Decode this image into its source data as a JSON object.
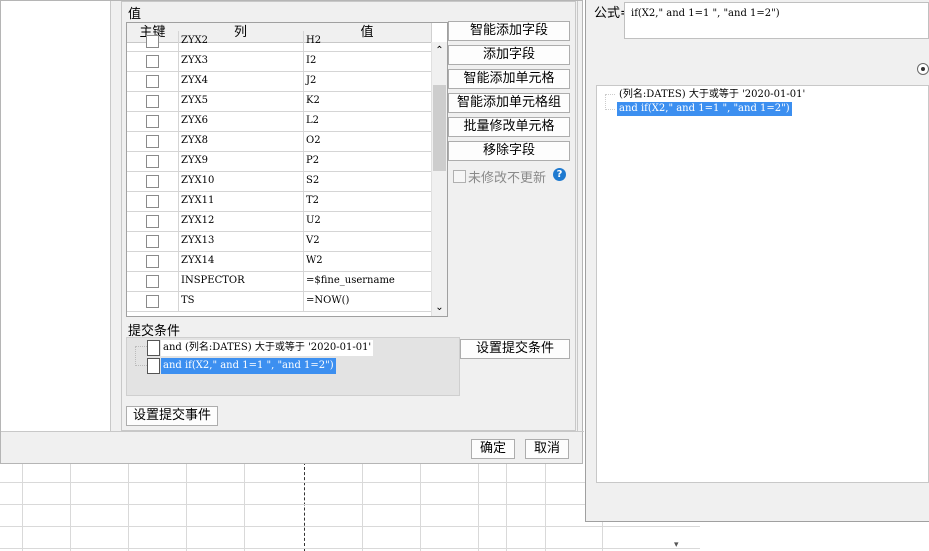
{
  "main_dialog": {
    "values_label": "值",
    "columns": {
      "key": "主键",
      "column": "列",
      "value": "值"
    },
    "rows": [
      {
        "column": "ZYX2",
        "value": "H2"
      },
      {
        "column": "ZYX3",
        "value": "I2"
      },
      {
        "column": "ZYX4",
        "value": "J2"
      },
      {
        "column": "ZYX5",
        "value": "K2"
      },
      {
        "column": "ZYX6",
        "value": "L2"
      },
      {
        "column": "ZYX8",
        "value": "O2"
      },
      {
        "column": "ZYX9",
        "value": "P2"
      },
      {
        "column": "ZYX10",
        "value": "S2"
      },
      {
        "column": "ZYX11",
        "value": "T2"
      },
      {
        "column": "ZYX12",
        "value": "U2"
      },
      {
        "column": "ZYX13",
        "value": "V2"
      },
      {
        "column": "ZYX14",
        "value": "W2"
      },
      {
        "column": "INSPECTOR",
        "value": "=$fine_username"
      },
      {
        "column": "TS",
        "value": "=NOW()"
      }
    ],
    "buttons": {
      "smart_add_field": "智能添加字段",
      "add_field": "添加字段",
      "smart_add_cell": "智能添加单元格",
      "smart_add_cell_group": "智能添加单元格组",
      "batch_modify_cells": "批量修改单元格",
      "remove_field": "移除字段",
      "set_submit_condition": "设置提交条件",
      "set_submit_event": "设置提交事件",
      "ok": "确定",
      "cancel": "取消"
    },
    "no_update_unmodified": "未修改不更新",
    "submit_condition_label": "提交条件",
    "conditions": [
      "and (列名:DATES) 大于或等于 '2020-01-01'",
      "and if(X2,\" and 1=1 \", \"and 1=2\")"
    ]
  },
  "formula_dialog": {
    "formula_label": "公式=",
    "formula_value": "if(X2,\" and 1=1 \", \"and 1=2\")",
    "conditions": [
      "(列名:DATES) 大于或等于 '2020-01-01'",
      "and if(X2,\" and 1=1 \", \"and 1=2\")"
    ]
  },
  "colors": {
    "selection": "#3c8ff0",
    "help": "#1f7ad0"
  }
}
